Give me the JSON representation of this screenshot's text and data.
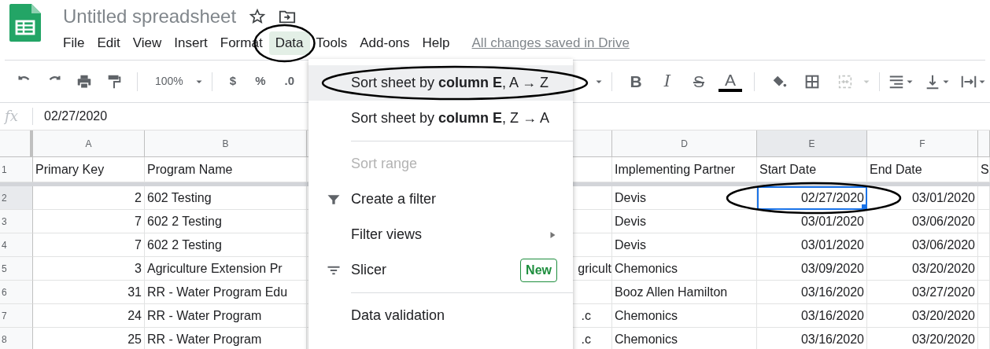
{
  "document": {
    "title": "Untitled spreadsheet"
  },
  "menus": [
    {
      "label": "File",
      "selected": false,
      "circled": false
    },
    {
      "label": "Edit",
      "selected": false,
      "circled": false
    },
    {
      "label": "View",
      "selected": false,
      "circled": false
    },
    {
      "label": "Insert",
      "selected": false,
      "circled": false
    },
    {
      "label": "Format",
      "selected": false,
      "circled": false
    },
    {
      "label": "Data",
      "selected": true,
      "circled": true
    },
    {
      "label": "Tools",
      "selected": false,
      "circled": false
    },
    {
      "label": "Add-ons",
      "selected": false,
      "circled": false
    },
    {
      "label": "Help",
      "selected": false,
      "circled": false
    }
  ],
  "save_status": "All changes saved in Drive",
  "toolbar": {
    "zoom": "100%",
    "currency": "$",
    "percent": "%",
    "decimal": ".0",
    "format_buttons": [
      {
        "kind": "bold",
        "label": "B"
      },
      {
        "kind": "italic",
        "label": "I"
      },
      {
        "kind": "strikethrough",
        "label": "S"
      },
      {
        "kind": "text-color",
        "label": "A"
      }
    ],
    "merge": {
      "disabled": true
    }
  },
  "formula_bar": {
    "symbol": "fx",
    "value": "02/27/2020"
  },
  "grid": {
    "selection_circled": true,
    "columns": [
      {
        "letter": "A"
      },
      {
        "letter": "B"
      },
      {},
      {
        "letter": "D"
      },
      {
        "letter": "E"
      },
      {
        "letter": "F"
      },
      {}
    ],
    "rows": [
      {
        "number": "1",
        "cells": [
          {
            "text": "Primary Key",
            "selected": false
          },
          {
            "text": "Program Name",
            "selected": false
          },
          {
            "selected": false
          },
          {
            "text": "Implementing Partner",
            "selected": false
          },
          {
            "text": "Start Date",
            "selected": false
          },
          {
            "text": "End Date",
            "selected": false
          },
          {
            "text": "S",
            "selected": false
          }
        ]
      },
      {
        "number": "2",
        "cells": [
          {
            "text": "2",
            "selected": false
          },
          {
            "text": "602 Testing",
            "selected": false
          },
          {
            "selected": false
          },
          {
            "text": "Devis",
            "selected": false
          },
          {
            "text": "02/27/2020",
            "selected": true
          },
          {
            "text": "03/01/2020",
            "selected": false
          },
          {
            "selected": false
          }
        ]
      },
      {
        "number": "3",
        "cells": [
          {
            "text": "7",
            "selected": false
          },
          {
            "text": "602 2 Testing",
            "selected": false
          },
          {
            "selected": false
          },
          {
            "text": "Devis",
            "selected": false
          },
          {
            "text": "03/01/2020",
            "selected": false
          },
          {
            "text": "03/06/2020",
            "selected": false
          },
          {
            "selected": false
          }
        ]
      },
      {
        "number": "4",
        "cells": [
          {
            "text": "7",
            "selected": false
          },
          {
            "text": "602 2 Testing",
            "selected": false
          },
          {
            "selected": false
          },
          {
            "text": "Devis",
            "selected": false
          },
          {
            "text": "03/01/2020",
            "selected": false
          },
          {
            "text": "03/06/2020",
            "selected": false
          },
          {
            "selected": false
          }
        ]
      },
      {
        "number": "5",
        "cells": [
          {
            "text": "3",
            "selected": false
          },
          {
            "text": "Agriculture Extension Pr",
            "selected": false
          },
          {
            "text": "gricult",
            "selected": false
          },
          {
            "text": "Chemonics",
            "selected": false
          },
          {
            "text": "03/09/2020",
            "selected": false
          },
          {
            "text": "03/20/2020",
            "selected": false
          },
          {
            "selected": false
          }
        ]
      },
      {
        "number": "6",
        "cells": [
          {
            "text": "31",
            "selected": false
          },
          {
            "text": "RR - Water Program Edu",
            "selected": false
          },
          {
            "selected": false
          },
          {
            "text": "Booz Allen Hamilton",
            "selected": false
          },
          {
            "text": "03/16/2020",
            "selected": false
          },
          {
            "text": "03/27/2020",
            "selected": false
          },
          {
            "selected": false
          }
        ]
      },
      {
        "number": "7",
        "cells": [
          {
            "text": "24",
            "selected": false
          },
          {
            "text": "RR - Water Program",
            "selected": false
          },
          {
            "text": ".c",
            "selected": false
          },
          {
            "text": "Chemonics",
            "selected": false
          },
          {
            "text": "03/16/2020",
            "selected": false
          },
          {
            "text": "03/20/2020",
            "selected": false
          },
          {
            "selected": false
          }
        ]
      },
      {
        "number": "8",
        "cells": [
          {
            "text": "25",
            "selected": false
          },
          {
            "text": "RR - Water Program",
            "selected": false
          },
          {
            "text": ".c",
            "selected": false
          },
          {
            "text": "Chemonics",
            "selected": false
          },
          {
            "text": "03/16/2020",
            "selected": false
          },
          {
            "text": "03/20/2020",
            "selected": false
          },
          {
            "selected": false
          }
        ]
      }
    ]
  },
  "data_menu": {
    "items": [
      {
        "kind": "item",
        "text": "Sort sheet by **column E**, A → Z",
        "highlighted": true,
        "disabled": false,
        "circled": true
      },
      {
        "kind": "item",
        "text": "Sort sheet by **column E**, Z → A",
        "highlighted": false,
        "disabled": false,
        "circled": false
      },
      {
        "kind": "divider"
      },
      {
        "kind": "item",
        "text": "Sort range",
        "highlighted": false,
        "disabled": true,
        "circled": false
      },
      {
        "kind": "filter",
        "text": "Create a filter",
        "highlighted": false,
        "disabled": false,
        "circled": false
      },
      {
        "kind": "submenu",
        "text": "Filter views",
        "highlighted": false,
        "disabled": false,
        "circled": false
      },
      {
        "kind": "slicer",
        "text": "Slicer",
        "badge": "New",
        "highlighted": false,
        "disabled": false,
        "circled": false
      },
      {
        "kind": "divider"
      },
      {
        "kind": "item",
        "text": "Data validation",
        "highlighted": false,
        "disabled": false,
        "circled": false
      }
    ]
  }
}
